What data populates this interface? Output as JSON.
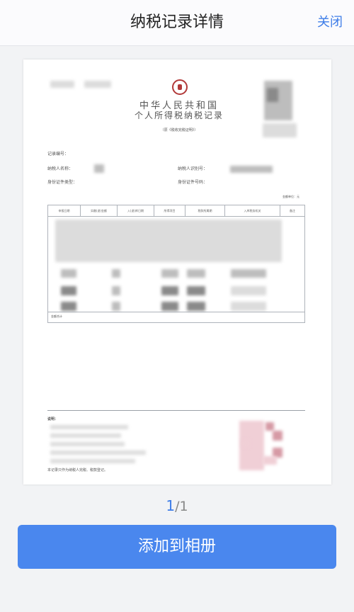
{
  "header": {
    "title": "纳税记录详情",
    "close_label": "关闭"
  },
  "document": {
    "org_line1": "中华人民共和国",
    "org_line2": "个人所得税纳税记录",
    "subtitle": "（原《税收完税证明》）",
    "record_no_label": "记录编号：",
    "taxpayer_name_label": "纳税人名称：",
    "taxpayer_id_label": "纳税人识别号：",
    "id_type_label": "身份证件类型：",
    "id_no_label": "身份证件号码：",
    "unit_label": "金额单位：元",
    "columns": [
      "申报日期",
      "实缴(退)金额",
      "入(退)库日期",
      "所得项目",
      "税款所属期",
      "入库税务机关",
      "备注"
    ],
    "total_label": "金额合计",
    "notes_title": "说明：",
    "notes_footer": "本记录只作为纳税人完税、税款登记。"
  },
  "pager": {
    "current": "1",
    "total": "/1"
  },
  "action": {
    "add_label": "添加到相册"
  }
}
